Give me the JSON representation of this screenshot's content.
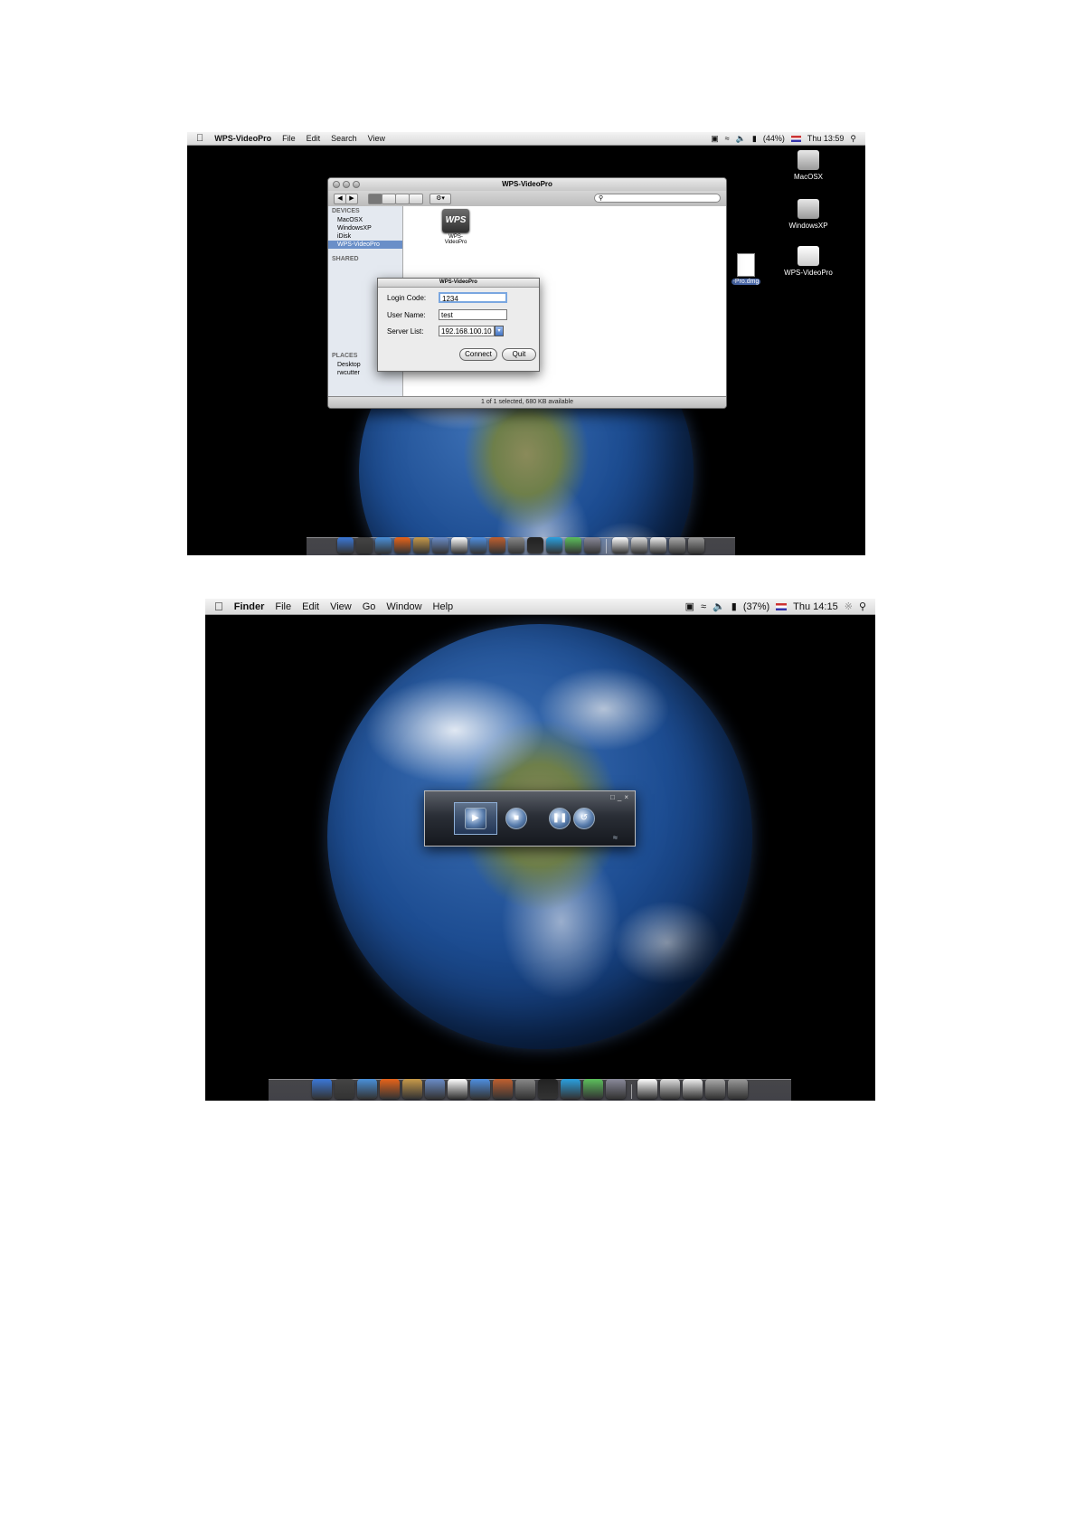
{
  "shot1": {
    "menubar": {
      "app": "WPS-VideoPro",
      "items": [
        "File",
        "Edit",
        "Search",
        "View"
      ],
      "battery": "(44%)",
      "time": "Thu 13:59"
    },
    "desktop_icons": [
      "MacOSX",
      "WindowsXP",
      "WPS-VideoPro"
    ],
    "finder": {
      "title": "WPS-VideoPro",
      "sidebar": {
        "devices_header": "DEVICES",
        "devices": [
          "MacOSX",
          "WindowsXP",
          "iDisk",
          "WPS-VideoPro"
        ],
        "shared_header": "SHARED",
        "places_header": "PLACES",
        "places": [
          "Desktop",
          "rwcutter"
        ]
      },
      "file_icon_text": "WPS",
      "file_label": "WPS-VideoPro",
      "status": "1 of 1 selected, 680 KB available"
    },
    "dmg_label": "-Pro.dmg",
    "login": {
      "title": "WPS-VideoPro",
      "login_code_label": "Login Code:",
      "login_code_value": "1234",
      "user_name_label": "User Name:",
      "user_name_value": "test",
      "server_list_label": "Server List:",
      "server_list_value": "192.168.100.10",
      "connect_label": "Connect",
      "quit_label": "Quit"
    }
  },
  "shot2": {
    "menubar": {
      "app": "Finder",
      "items": [
        "File",
        "Edit",
        "View",
        "Go",
        "Window",
        "Help"
      ],
      "battery": "(37%)",
      "time": "Thu 14:15"
    },
    "player": {
      "play_icon": "play-icon",
      "stop_icon": "stop-icon",
      "pause_icon": "pause-icon",
      "refresh_icon": "refresh-icon"
    }
  },
  "dock_colors": [
    "#3b78d8",
    "#444444",
    "#4a90d9",
    "#e8641a",
    "#c89a4a",
    "#6a8cc8",
    "#ffffff",
    "#4f8fe0",
    "#c06030",
    "#888888",
    "#222222",
    "#2aa0e0",
    "#5cc05c",
    "#8a8a9a",
    "#ffffff",
    "#dddddd",
    "#eeeeee",
    "#aaaaaa",
    "#999999"
  ]
}
